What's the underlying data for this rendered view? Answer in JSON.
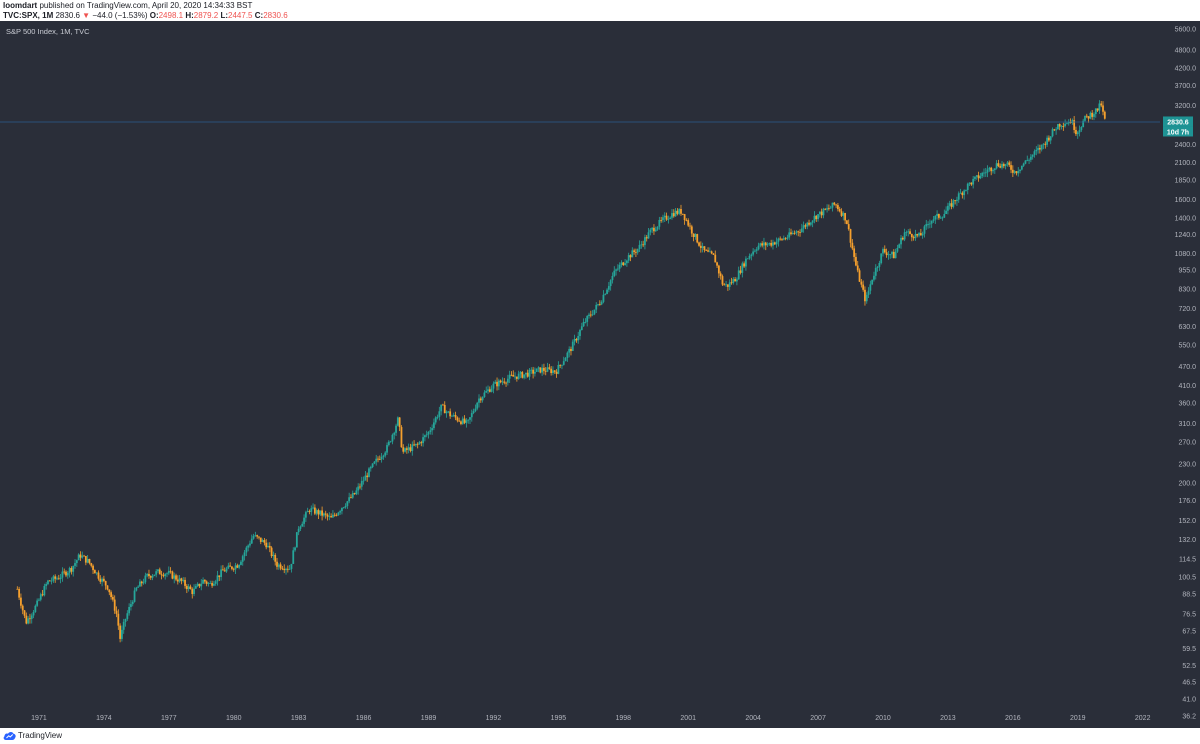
{
  "header": {
    "publisher": "loomdart",
    "published_text": "published on TradingView.com, April 20, 2020 14:34:33 BST",
    "symbol": "TVC:SPX, 1M",
    "last": "2830.6",
    "arrow": "▼",
    "change": "−44.0 (−1.53%)",
    "o_label": "O:",
    "o_value": "2498.1",
    "h_label": "H:",
    "h_value": "2879.2",
    "l_label": "L:",
    "l_value": "2447.5",
    "c_label": "C:",
    "c_value": "2830.6"
  },
  "chart_title": "S&P 500 Index, 1M, TVC",
  "footer": {
    "brand": "TradingView"
  },
  "colors": {
    "background": "#2a2e39",
    "up": "#26a69a",
    "down": "#f6a02d",
    "axis_text": "#b2b5be",
    "price_line": "#2a5d8f",
    "price_label_bg": "#1e9394"
  },
  "chart_data": {
    "type": "line",
    "title": "S&P 500 Index, 1M, TVC",
    "scale": "log",
    "ylim": [
      36.2,
      5600
    ],
    "y_ticks": [
      "5600.0",
      "4800.0",
      "4200.0",
      "3700.0",
      "3200.0",
      "2400.0",
      "2100.0",
      "1850.0",
      "1600.0",
      "1400.0",
      "1240.0",
      "1080.0",
      "955.0",
      "830.0",
      "720.0",
      "630.0",
      "550.0",
      "470.0",
      "410.0",
      "360.0",
      "310.0",
      "270.0",
      "230.0",
      "200.0",
      "176.0",
      "152.0",
      "132.0",
      "114.5",
      "100.5",
      "88.5",
      "76.5",
      "67.5",
      "59.5",
      "52.5",
      "46.5",
      "41.0",
      "36.2"
    ],
    "x_ticks": [
      "1971",
      "1974",
      "1977",
      "1980",
      "1983",
      "1986",
      "1989",
      "1992",
      "1995",
      "1998",
      "2001",
      "2004",
      "2007",
      "2010",
      "2013",
      "2016",
      "2019",
      "2022"
    ],
    "xlim": [
      1969.2,
      2022.8
    ],
    "current_price_label": "2830.6",
    "countdown_label": "10d 7h",
    "current_price": 2830.6,
    "series": [
      {
        "x": [
          1970.0,
          1970.4,
          1970.9,
          1971.4,
          1971.9,
          1972.5,
          1972.9,
          1973.3,
          1973.8,
          1974.2,
          1974.6,
          1974.75,
          1975.0,
          1975.5,
          1976.0,
          1976.5,
          1977.0,
          1977.6,
          1978.1,
          1978.6,
          1978.9,
          1979.5,
          1980.2,
          1980.9,
          1981.5,
          1982.0,
          1982.6,
          1983.0,
          1983.5,
          1984.0,
          1984.5,
          1985.0,
          1985.6,
          1986.1,
          1986.6,
          1987.1,
          1987.6,
          1987.8,
          1988.0,
          1988.5,
          1989.0,
          1989.6,
          1990.0,
          1990.8,
          1991.3,
          1992.0,
          1992.8,
          1993.5,
          1994.2,
          1994.9,
          1995.6,
          1996.2,
          1996.9,
          1997.6,
          1998.2,
          1998.7,
          1999.3,
          1999.9,
          2000.3,
          2000.7,
          2001.2,
          2001.7,
          2002.2,
          2002.6,
          2002.8,
          2003.2,
          2003.7,
          2004.2,
          2004.8,
          2005.5,
          2006.2,
          2006.9,
          2007.5,
          2007.8,
          2008.3,
          2008.8,
          2009.2,
          2009.5,
          2010.0,
          2010.5,
          2011.0,
          2011.7,
          2012.2,
          2012.8,
          2013.4,
          2014.0,
          2014.7,
          2015.3,
          2015.8,
          2016.1,
          2016.7,
          2017.3,
          2017.9,
          2018.1,
          2018.7,
          2018.95,
          2019.3,
          2019.9,
          2020.1,
          2020.2,
          2020.3
        ],
        "y": [
          92,
          72,
          82,
          97,
          100,
          107,
          118,
          112,
          100,
          93,
          76,
          64,
          74,
          92,
          101,
          104,
          103,
          97,
          90,
          98,
          95,
          105,
          110,
          136,
          128,
          110,
          107,
          145,
          165,
          160,
          154,
          168,
          185,
          210,
          236,
          260,
          320,
          250,
          255,
          265,
          290,
          350,
          330,
          308,
          370,
          410,
          435,
          445,
          460,
          455,
          540,
          650,
          750,
          940,
          1050,
          1120,
          1280,
          1390,
          1450,
          1470,
          1260,
          1100,
          1050,
          860,
          850,
          900,
          1040,
          1140,
          1160,
          1210,
          1290,
          1420,
          1500,
          1550,
          1390,
          950,
          760,
          900,
          1100,
          1060,
          1260,
          1220,
          1380,
          1440,
          1620,
          1800,
          1960,
          2080,
          2050,
          1960,
          2150,
          2350,
          2660,
          2780,
          2860,
          2620,
          2880,
          3100,
          3230,
          2900,
          2830
        ]
      }
    ]
  }
}
